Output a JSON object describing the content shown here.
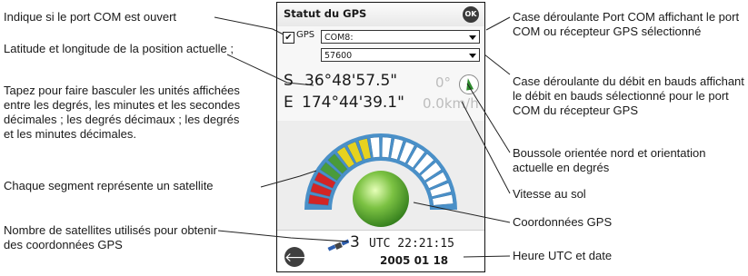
{
  "device": {
    "title": "Statut du GPS",
    "ok_label": "OK",
    "gps_checkbox": {
      "label": "GPS",
      "checked": true,
      "mark": "✔"
    },
    "com_port_value": "COM8:",
    "baud_rate_value": "57600",
    "latitude": {
      "hemisphere": "S",
      "value": "36°48'57.5\""
    },
    "longitude": {
      "hemisphere": "E",
      "value": "174°44'39.1\""
    },
    "heading": "0°",
    "speed": "0.0km/h",
    "satellites_used": "3",
    "utc_time": "UTC 22:21:15",
    "date": "2005 01 18",
    "back_arrow": "🡐",
    "gauge_segment_colors": [
      "#d32525",
      "#d32525",
      "#d32525",
      "#4a9b3a",
      "#4a9b3a",
      "#e6d21f",
      "#e6d21f",
      "#e6d21f",
      "#ffffff",
      "#ffffff",
      "#ffffff",
      "#ffffff",
      "#ffffff",
      "#ffffff",
      "#ffffff",
      "#ffffff",
      "#ffffff",
      "#ffffff"
    ],
    "gauge_color": "#4a90c8",
    "globe_color": "#7cc243"
  },
  "annotations": {
    "com_port_open": "Indique si le port COM est ouvert",
    "lat_long": "Latitude et longitude de la position actuelle ;",
    "toggle_units": "Tapez pour faire basculer les unités affichées entre les degrés, les minutes et les secondes décimales ; les degrés décimaux ; les degrés et les minutes décimales.",
    "segment_satellite": "Chaque segment représente un satellite",
    "satellites_count": "Nombre de satellites utilisés pour obtenir des coordonnées GPS",
    "com_port_dropdown": "Case déroulante Port COM affichant le port COM ou récepteur GPS sélectionné",
    "baud_dropdown": "Case déroulante du débit en bauds affichant le débit en bauds sélectionné pour le port COM du récepteur GPS",
    "compass": "Boussole orientée nord et orientation actuelle en degrés",
    "ground_speed": "Vitesse au sol",
    "gps_coordinates": "Coordonnées GPS",
    "utc_date": "Heure UTC et date"
  }
}
